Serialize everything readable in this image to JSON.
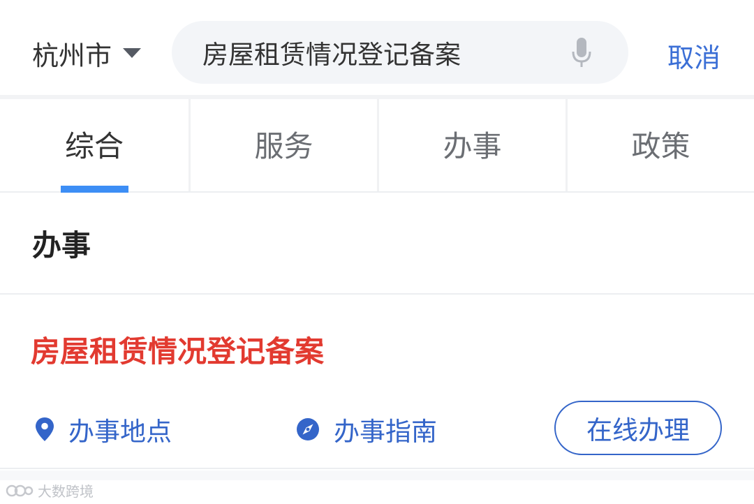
{
  "header": {
    "city": "杭州市",
    "search_value": "房屋租赁情况登记备案",
    "cancel_label": "取消"
  },
  "tabs": [
    {
      "label": "综合",
      "active": true
    },
    {
      "label": "服务",
      "active": false
    },
    {
      "label": "办事",
      "active": false
    },
    {
      "label": "政策",
      "active": false
    }
  ],
  "section": {
    "title": "办事"
  },
  "result": {
    "title": "房屋租赁情况登记备案",
    "place_label": "办事地点",
    "guide_label": "办事指南",
    "online_label": "在线办理"
  },
  "watermark": {
    "text": "大数跨境"
  },
  "colors": {
    "accent_blue": "#3465c9",
    "tab_underline": "#3d8ef5",
    "result_title_red": "#e23a30",
    "search_bg": "#f3f5f8"
  },
  "icons": {
    "city_dropdown": "caret-down-icon",
    "search_mic": "microphone-icon",
    "place": "location-pin-icon",
    "guide": "compass-icon"
  }
}
